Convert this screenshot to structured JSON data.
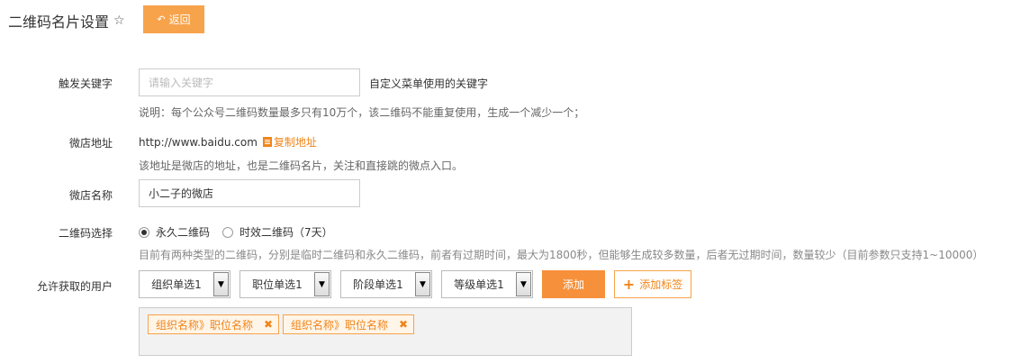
{
  "header": {
    "title": "二维码名片设置",
    "back_label": "返回"
  },
  "keyword": {
    "label": "触发关键字",
    "placeholder": "请输入关键字",
    "side_hint": "自定义菜单使用的关键字",
    "note": "说明：每个公众号二维码数量最多只有10万个，该二维码不能重复使用，生成一个减少一个；"
  },
  "shop_address": {
    "label": "微店地址",
    "url": "http://www.baidu.com",
    "copy_label": "复制地址",
    "note": "该地址是微店的地址，也是二维码名片，关注和直接跳的微点入口。"
  },
  "shop_name": {
    "label": "微店名称",
    "value": "小二子的微店"
  },
  "qr_choice": {
    "label": "二维码选择",
    "options": [
      {
        "label": "永久二维码",
        "checked": true
      },
      {
        "label": "时效二维码（7天）",
        "checked": false
      }
    ],
    "note": "目前有两种类型的二维码，分别是临时二维码和永久二维码，前者有过期时间，最大为1800秒，但能够生成较多数量，后者无过期时间，数量较少（目前参数只支持1~10000）"
  },
  "allowed_users": {
    "label": "允许获取的用户",
    "selects": [
      "组织单选1",
      "职位单选1",
      "阶段单选1",
      "等级单选1"
    ],
    "add_label": "添加",
    "add_tag_label": "添加标签",
    "tags": [
      "组织名称》职位名称",
      "组织名称》职位名称"
    ]
  },
  "colors": {
    "accent": "#f7a34b",
    "accent_text": "#f08519"
  }
}
